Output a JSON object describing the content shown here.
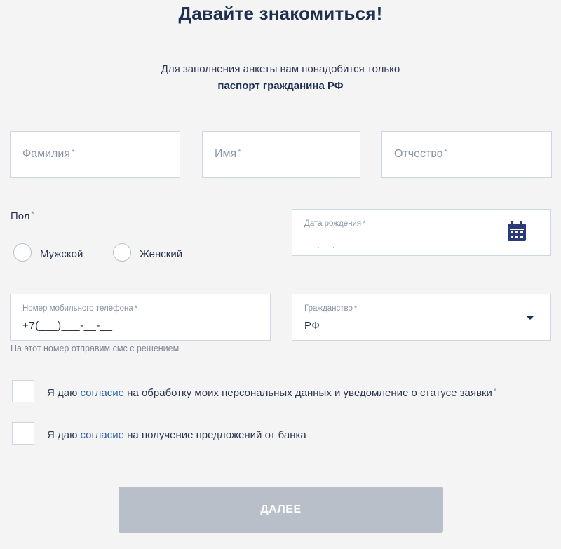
{
  "title": "Давайте знакомиться!",
  "intro": {
    "line1": "Для заполнения анкеты вам понадобится только",
    "line2": "паспорт гражданина РФ"
  },
  "fields": {
    "lastname": {
      "placeholder": "Фамилия",
      "required": "*"
    },
    "firstname": {
      "placeholder": "Имя",
      "required": "*"
    },
    "patronymic": {
      "placeholder": "Отчество",
      "required": "*"
    },
    "birthdate": {
      "label": "Дата рождения",
      "required": "*",
      "value": "__.__.____",
      "icon": "calendar-icon"
    },
    "phone": {
      "label": "Номер мобильного телефона",
      "required": "*",
      "value": "+7(___)___-__-__",
      "hint": "На этот номер отправим смс с решением"
    },
    "citizenship": {
      "label": "Гражданство",
      "required": "*",
      "value": "РФ",
      "icon": "chevron-down-icon"
    }
  },
  "gender": {
    "label": "Пол",
    "required": "*",
    "options": [
      "Мужской",
      "Женский"
    ]
  },
  "consents": [
    {
      "prefix": "Я даю ",
      "link": "согласие",
      "suffix": " на обработку моих персональных данных и уведомление о статусе заявки",
      "required": "*"
    },
    {
      "prefix": "Я даю ",
      "link": "согласие",
      "suffix": " на получение предложений от банка",
      "required": ""
    }
  ],
  "button": {
    "label": "ДАЛЕЕ"
  },
  "colors": {
    "accent": "#2a5ea8",
    "title": "#1e2f4f",
    "button_disabled": "#b8bfc9",
    "calendar_icon": "#2d3a78"
  }
}
